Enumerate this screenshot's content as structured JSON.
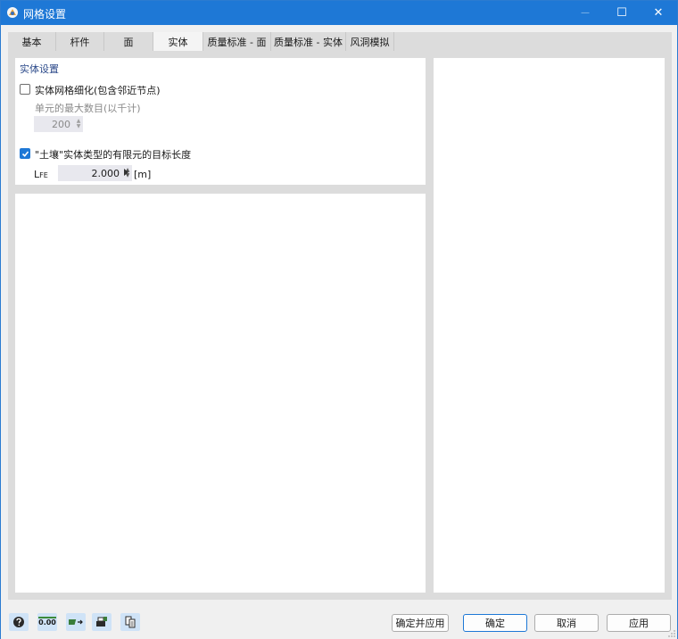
{
  "window": {
    "title": "网格设置",
    "minimize_glyph": "—",
    "maximize_glyph": "☐",
    "close_glyph": "✕"
  },
  "tabs": [
    {
      "label": "基本",
      "active": false
    },
    {
      "label": "杆件",
      "active": false
    },
    {
      "label": "面",
      "active": false
    },
    {
      "label": "实体",
      "active": true
    },
    {
      "label": "质量标准 - 面",
      "active": false
    },
    {
      "label": "质量标准 - 实体",
      "active": false
    },
    {
      "label": "风洞模拟",
      "active": false
    }
  ],
  "solid_settings": {
    "section_title": "实体设置",
    "refine_mesh": {
      "label": "实体网格细化(包含邻近节点)",
      "checked": false
    },
    "max_elements": {
      "label": "单元的最大数目(以千计)",
      "value": "200",
      "enabled": false
    },
    "soil_target_length": {
      "label": "\"土壤\"实体类型的有限元的目标长度",
      "checked": true
    },
    "lfe": {
      "symbol_main": "L",
      "symbol_sub": "FE",
      "value": "2.000",
      "unit": "[m]"
    }
  },
  "footer": {
    "tool_icons": [
      "help-icon",
      "units-decimal-icon",
      "view-model-icon",
      "print-icon",
      "copy-settings-icon"
    ],
    "units_icon_text": "0.00",
    "buttons": {
      "ok_apply": "确定并应用",
      "ok": "确定",
      "cancel": "取消",
      "apply": "应用"
    }
  },
  "colors": {
    "title_bar": "#1e78d6",
    "accent": "#1e78d6",
    "section_title": "#2c4a8a"
  }
}
